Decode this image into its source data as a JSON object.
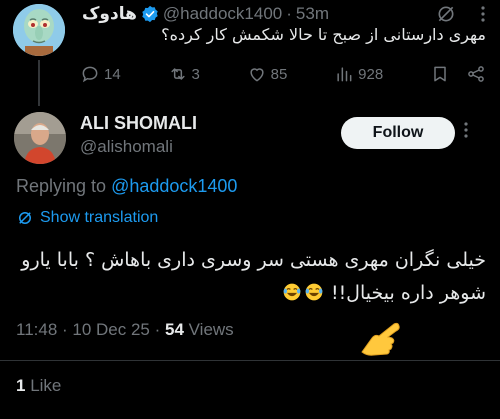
{
  "parent_tweet": {
    "display_name": "هادوک",
    "handle": "@haddock1400",
    "separator": "·",
    "time_ago": "53m",
    "text": "مهری دارستانی از صبح تا حالا شکمش کار کرده؟",
    "verified": true,
    "avatar_icon": "squidward-avatar",
    "actions": {
      "replies": "14",
      "reposts": "3",
      "likes": "85",
      "views": "928"
    }
  },
  "main_tweet": {
    "author_name": "ALI SHOMALI",
    "author_handle": "@alishomali",
    "follow_label": "Follow",
    "replying_prefix": "Replying to",
    "replying_to": "@haddock1400",
    "show_translation_label": "Show translation",
    "text_line1": "خیلی نگران مهری هستی سر وسری داری باهاش ؟ بابا یارو",
    "text_line2": "شوهر داره بیخیال!!",
    "timestamp": "11:48 · 10 Dec 25 · ",
    "views_count": "54",
    "views_label": " Views",
    "likes_count": "1",
    "likes_label": " Like"
  },
  "colors": {
    "background": "#000000",
    "text": "#e7e9ea",
    "muted": "#71767b",
    "accent": "#1d9bf0",
    "follow_bg": "#eff3f4"
  },
  "icons": [
    "verified-badge-icon",
    "grok-icon",
    "more-icon",
    "reply-icon",
    "repost-icon",
    "like-icon",
    "views-icon",
    "bookmark-icon",
    "share-icon",
    "translate-icon",
    "laughing-emoji-icon",
    "pointing-hand-emoji-icon"
  ]
}
